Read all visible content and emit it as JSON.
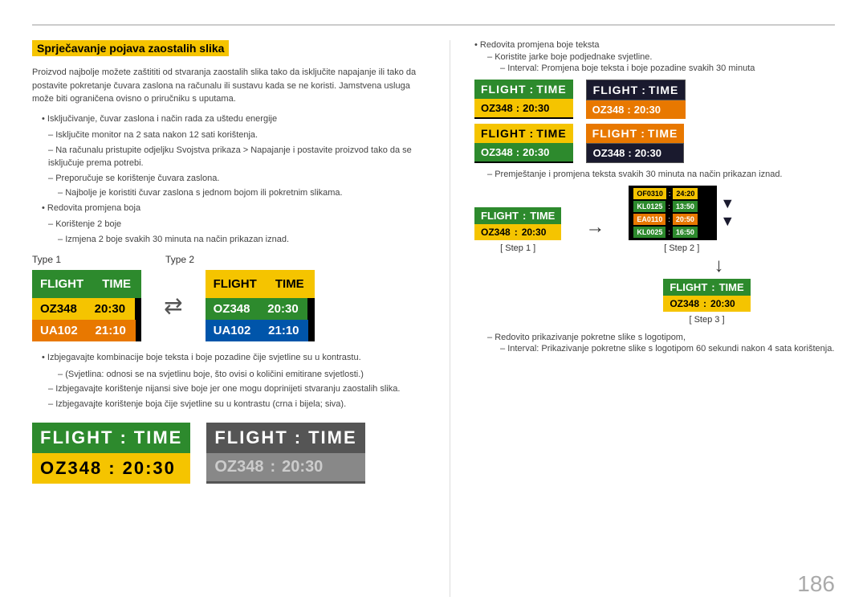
{
  "page": {
    "number": "186"
  },
  "header": {
    "title": "Sprječavanje pojava zaostalih slika"
  },
  "left": {
    "intro": "Proizvod najbolje možete zaštititi od stvaranja zaostalih slika tako da isključite napajanje ili tako da postavite pokretanje čuvara zaslona na računalu ili sustavu kada se ne koristi. Jamstvena usluga može biti ograničena ovisno o priručniku s uputama.",
    "bullet1": "Isključivanje, čuvar zaslona i način rada za uštedu energije",
    "dash1_1": "Isključite monitor na 2 sata nakon 12 sati korištenja.",
    "dash1_2": "Na računalu pristupite odjeljku Svojstva prikaza > Napajanje i postavite proizvod tako da se isključuje prema potrebi.",
    "dash1_3": "Preporučuje se korištenje čuvara zaslona.",
    "sub1": "Najbolje je koristiti čuvar zaslona s jednom bojom ili pokretnim slikama.",
    "bullet2": "Redovita promjena boja",
    "dash2_1": "Korištenje 2 boje",
    "sub2": "Izmjena 2 boje svakih 30 minuta na način prikazan iznad.",
    "type1_label": "Type 1",
    "type2_label": "Type 2",
    "board1": {
      "header_col1": "FLIGHT",
      "header_col2": "TIME",
      "row1_col1": "OZ348",
      "row1_col2": "20:30",
      "row2_col1": "UA102",
      "row2_col2": "21:10"
    },
    "bullet3": "Izbjegavajte kombinacije boje teksta i boje pozadine čije svjetline su u kontrastu.",
    "sub3": "(Svjetlina: odnosi se na svjetlinu boje, što ovisi o količini emitirane svjetlosti.)",
    "dash3": "Izbjegavajte korištenje nijansi sive boje jer one mogu doprinijeti stvaranju zaostalih slika.",
    "dash4": "Izbjegavajte korištenje boja čije svjetline su u kontrastu (crna i bijela; siva).",
    "bottom_board1": {
      "header_col1": "FLIGHT",
      "colon": ":",
      "header_col2": "TIME",
      "row1_col1": "OZ348",
      "row1_col2": "20:30"
    },
    "bottom_board2": {
      "header_col1": "FLIGHT",
      "colon": ":",
      "header_col2": "TIME",
      "row1_col1": "OZ348",
      "row1_col2": "20:30"
    }
  },
  "right": {
    "bullet1": "Redovita promjena boje teksta",
    "dash1": "Koristite jarke boje podjednake svjetline.",
    "sub1": "Interval: Promjena boje teksta i boje pozadine svakih 30 minuta",
    "grid": {
      "board1": {
        "bg": "#2d8a2d",
        "header": "FLIGHT   :   TIME",
        "row": "OZ348   :   20:30",
        "header_color": "#fff",
        "row_bg": "#f5c400",
        "row_color": "#000"
      },
      "board2": {
        "bg": "#1a1a2e",
        "header": "FLIGHT   :   TIME",
        "row": "OZ348   :   20:30",
        "header_color": "#fff",
        "row_bg": "#e87800",
        "row_color": "#fff"
      },
      "board3": {
        "bg": "#f5c400",
        "header": "FLIGHT   :   TIME",
        "row": "OZ348   :   20:30",
        "header_color": "#000",
        "row_bg": "#2d8a2d",
        "row_color": "#fff"
      },
      "board4": {
        "bg": "#e87800",
        "header": "FLIGHT   :   TIME",
        "row": "OZ348   :   20:30",
        "header_color": "#fff",
        "row_bg": "#1a1a2e",
        "row_color": "#fff"
      }
    },
    "note_dash": "Premještanje i promjena teksta svakih 30 minuta na način prikazan iznad.",
    "step1_label": "[ Step 1 ]",
    "step2_label": "[ Step 2 ]",
    "step3_label": "[ Step 3 ]",
    "step1_board": {
      "header_col1": "FLIGHT",
      "colon": ":",
      "header_col2": "TIME",
      "row1_col1": "OZ348",
      "row1_col2": "20:30"
    },
    "step2_rows": [
      {
        "col1": "OF0310",
        "col2": "24:20"
      },
      {
        "col1": "KL0125",
        "col2": "13:50"
      },
      {
        "col1": "EA0110",
        "col2": "20:50"
      },
      {
        "col1": "KL0025",
        "col2": "16:50"
      }
    ],
    "step3_board": {
      "header_col1": "FLIGHT",
      "colon": ":",
      "header_col2": "TIME",
      "row1_col1": "OZ348",
      "row1_col2": "20:30"
    },
    "final_bullet": "Redovito prikazivanje pokretne slike s logotipom,",
    "final_sub": "Interval: Prikazivanje pokretne slike s logotipom 60 sekundi nakon 4 sata korištenja."
  }
}
